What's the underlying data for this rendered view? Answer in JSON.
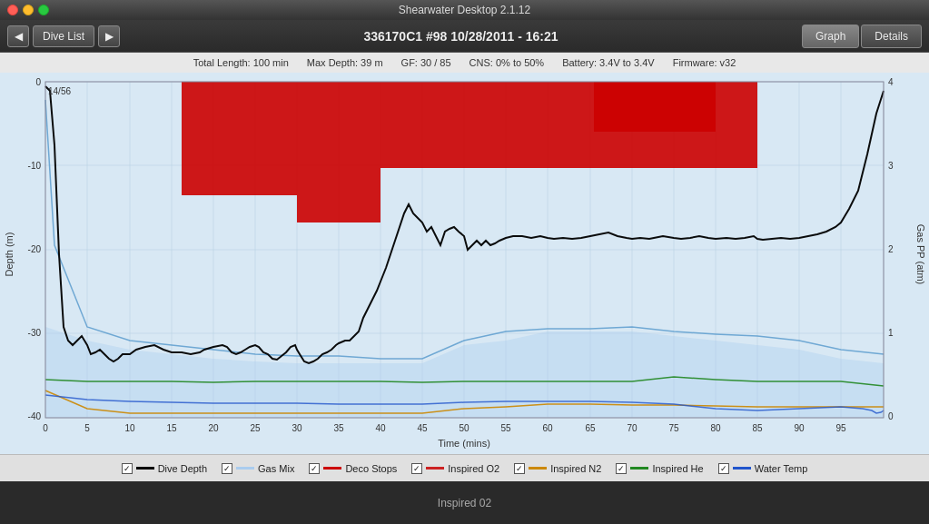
{
  "titleBar": {
    "title": "Shearwater Desktop 2.1.12"
  },
  "toolbar": {
    "navLeft": "◀",
    "navRight": "▶",
    "diveListLabel": "Dive List",
    "centerTitle": "336170C1 #98 10/28/2011 - 16:21",
    "graphLabel": "Graph",
    "detailsLabel": "Details"
  },
  "statsBar": {
    "totalLength": "Total Length: 100 min",
    "maxDepth": "Max Depth: 39 m",
    "gf": "GF: 30 / 85",
    "cns": "CNS: 0% to 50%",
    "battery": "Battery: 3.4V to 3.4V",
    "firmware": "Firmware: v32"
  },
  "chart": {
    "xAxisLabel": "Time (mins)",
    "yLeftLabel": "Depth (m)",
    "yRightLabel": "Gas PP (atm)",
    "xTicks": [
      0,
      5,
      10,
      15,
      20,
      25,
      30,
      35,
      40,
      45,
      50,
      55,
      60,
      65,
      70,
      75,
      80,
      85,
      90,
      95
    ],
    "yLeftTicks": [
      0,
      -10,
      -20,
      -30,
      -40
    ],
    "yRightTicks": [
      0,
      1,
      2,
      3,
      4
    ],
    "annotation": "14/56"
  },
  "legend": {
    "items": [
      {
        "label": "Dive Depth",
        "color": "#000000",
        "checked": true
      },
      {
        "label": "Gas Mix",
        "color": "#aaccee",
        "checked": true
      },
      {
        "label": "Deco Stops",
        "color": "#cc0000",
        "checked": true
      },
      {
        "label": "Inspired O2",
        "color": "#cc0000",
        "checked": true,
        "lineType": "solid"
      },
      {
        "label": "Inspired N2",
        "color": "#cc8800",
        "checked": true
      },
      {
        "label": "Inspired He",
        "color": "#228822",
        "checked": true
      },
      {
        "label": "Water Temp",
        "color": "#2255cc",
        "checked": true
      }
    ]
  },
  "bottomLabel": "Inspired 02"
}
